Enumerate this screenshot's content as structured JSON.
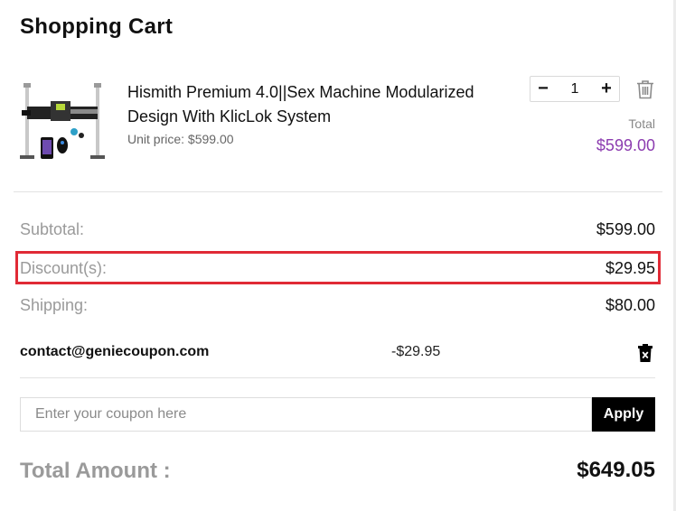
{
  "cart": {
    "title": "Shopping Cart"
  },
  "item": {
    "name": "Hismith Premium 4.0||Sex Machine Modularized Design With KlicLok System",
    "unit_price": "Unit price: $599.00",
    "quantity": "1",
    "minus": "−",
    "plus": "+",
    "total_label": "Total",
    "total_value": "$599.00",
    "image_icon": "product-photo",
    "delete_icon": "trash-icon"
  },
  "summary": {
    "subtotal_label": "Subtotal:",
    "subtotal_value": "$599.00",
    "discount_label": "Discount(s):",
    "discount_value": "$29.95",
    "shipping_label": "Shipping:",
    "shipping_value": "$80.00"
  },
  "applied_coupon": {
    "code": "contact@geniecoupon.com",
    "amount": "-$29.95",
    "remove_icon": "delete-coupon-icon"
  },
  "coupon_form": {
    "placeholder": "Enter your coupon here",
    "value": "",
    "apply_label": "Apply"
  },
  "grand_total": {
    "label": "Total Amount :",
    "value": "$649.05"
  },
  "colors": {
    "price_accent": "#8c3cb0",
    "highlight_border": "#e02a35",
    "button_bg": "#000000"
  }
}
